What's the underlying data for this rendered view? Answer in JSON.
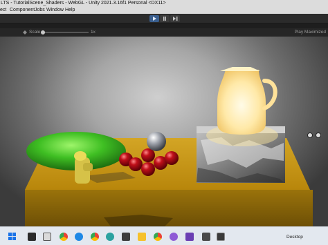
{
  "window": {
    "title": "LTS - TutorialScene_Shaders - WebGL - Unity 2021.3.16f1 Personal <DX11>"
  },
  "menu": {
    "items": [
      "ect",
      "Component",
      "Jobs",
      "Window",
      "Help"
    ]
  },
  "game_view": {
    "scale_label": "Scale",
    "scale_value": "1x",
    "play_maximized": "Play Maximized"
  },
  "taskbar": {
    "desktop_label": "Desktop",
    "icons": [
      "start-icon",
      "search-icon",
      "task-view-icon",
      "mail-icon",
      "store-icon",
      "chrome-icon",
      "edge-icon",
      "chrome-icon",
      "edge-icon",
      "notes-icon",
      "chrome-icon",
      "gamepad-icon",
      "visual-studio-icon",
      "arrow-icon",
      "unity-icon"
    ]
  }
}
